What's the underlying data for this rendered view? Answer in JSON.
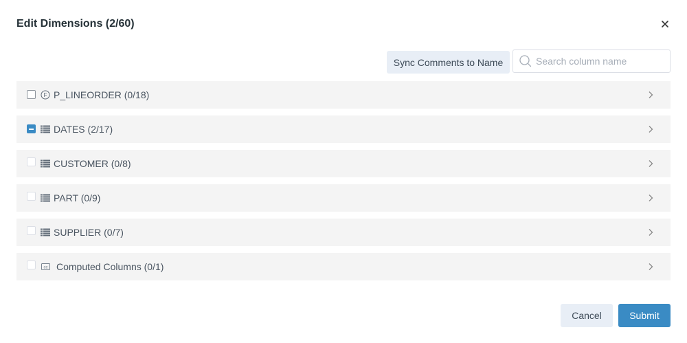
{
  "dialog": {
    "title": "Edit Dimensions (2/60)",
    "sync_label": "Sync Comments to Name",
    "search_placeholder": "Search column name",
    "cancel_label": "Cancel",
    "submit_label": "Submit"
  },
  "tables": [
    {
      "label": "P_LINEORDER",
      "count": "(0/18)",
      "icon": "fact-table-icon",
      "checkbox": "unchecked"
    },
    {
      "label": "DATES",
      "count": "(2/17)",
      "icon": "lookup-table-icon",
      "checkbox": "indeterminate"
    },
    {
      "label": "CUSTOMER",
      "count": "(0/8)",
      "icon": "lookup-table-icon",
      "checkbox": "unchecked"
    },
    {
      "label": "PART",
      "count": "(0/9)",
      "icon": "lookup-table-icon",
      "checkbox": "unchecked"
    },
    {
      "label": "SUPPLIER",
      "count": "(0/7)",
      "icon": "lookup-table-icon",
      "checkbox": "unchecked"
    },
    {
      "label": "Computed Columns",
      "count": "(0/1)",
      "icon": "computed-column-icon",
      "checkbox": "unchecked"
    }
  ],
  "colors": {
    "accent": "#3a8bc4",
    "row_bg": "#f4f4f4",
    "secondary_btn_bg": "#e8eef6"
  }
}
